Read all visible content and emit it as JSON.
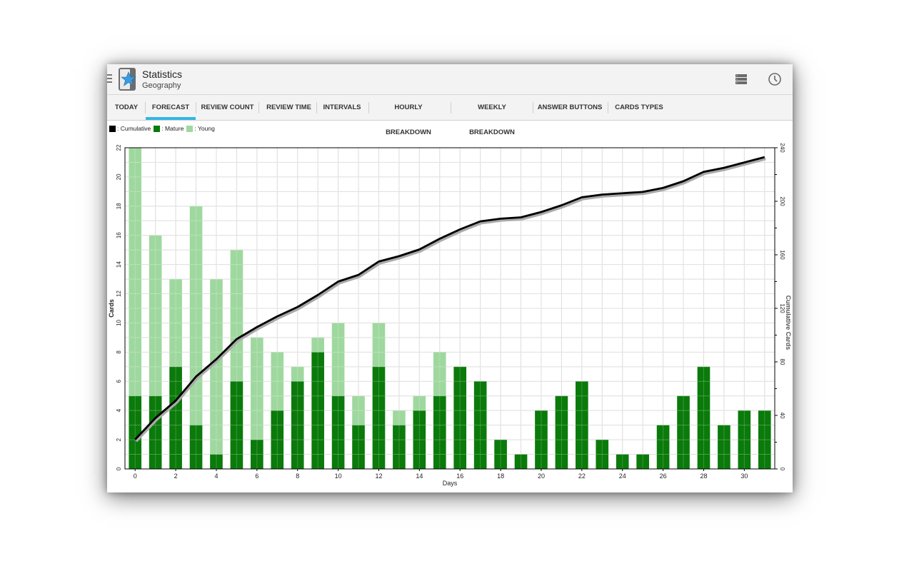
{
  "header": {
    "title": "Statistics",
    "subtitle": "Geography"
  },
  "icons": {
    "menu": "hamburger-icon",
    "app": "anki-app-icon",
    "deck_list": "list-icon",
    "time_scope": "clock-icon"
  },
  "tabs": [
    {
      "label": "TODAY"
    },
    {
      "label": "FORECAST"
    },
    {
      "label": "REVIEW COUNT"
    },
    {
      "label": "REVIEW TIME"
    },
    {
      "label": "INTERVALS"
    },
    {
      "label": "HOURLY BREAKDOWN"
    },
    {
      "label": "WEEKLY BREAKDOWN"
    },
    {
      "label": "ANSWER BUTTONS"
    },
    {
      "label": "CARDS TYPES"
    }
  ],
  "active_tab": "FORECAST",
  "colors": {
    "accent": "#33b5e5",
    "mature": "#0a7a0a",
    "young": "#9fd89f",
    "cumulative": "#000000"
  },
  "legend": [
    {
      "label": ": Cumulative",
      "color": "#000000"
    },
    {
      "label": ": Mature",
      "color": "#0a7a0a"
    },
    {
      "label": ": Young",
      "color": "#9fd89f"
    }
  ],
  "chart_data": {
    "type": "bar",
    "stacked": true,
    "xlabel": "Days",
    "ylabel": "Cards",
    "y2label": "Cumulative Cards",
    "x_ticks": [
      "0",
      "2",
      "4",
      "6",
      "8",
      "10",
      "12",
      "14",
      "16",
      "18",
      "20",
      "22",
      "24",
      "26",
      "28",
      "30"
    ],
    "y_ticks": [
      "0",
      "2",
      "4",
      "6",
      "8",
      "10",
      "12",
      "14",
      "16",
      "18",
      "20",
      "22"
    ],
    "y2_ticks": [
      "0",
      "40",
      "80",
      "120",
      "160",
      "200",
      "240"
    ],
    "xlim": [
      -0.5,
      31.5
    ],
    "ylim": [
      0,
      22
    ],
    "y2lim": [
      0,
      240
    ],
    "grid": true,
    "x": [
      0,
      1,
      2,
      3,
      4,
      5,
      6,
      7,
      8,
      9,
      10,
      11,
      12,
      13,
      14,
      15,
      16,
      17,
      18,
      19,
      20,
      21,
      22,
      23,
      24,
      25,
      26,
      27,
      28,
      29,
      30,
      31
    ],
    "series": [
      {
        "name": "Mature",
        "values": [
          5,
          5,
          7,
          3,
          1,
          6,
          2,
          4,
          6,
          8,
          5,
          3,
          7,
          3,
          4,
          5,
          7,
          6,
          2,
          1,
          4,
          5,
          6,
          2,
          1,
          1,
          3,
          5,
          7,
          3,
          4,
          4
        ]
      },
      {
        "name": "Young",
        "values": [
          17,
          11,
          6,
          15,
          12,
          9,
          7,
          4,
          1,
          1,
          5,
          2,
          3,
          1,
          1,
          3,
          0,
          0,
          0,
          0,
          0,
          0,
          0,
          0,
          0,
          0,
          0,
          0,
          0,
          0,
          0,
          0
        ]
      },
      {
        "name": "Cumulative",
        "axis": "right",
        "values": [
          22,
          38,
          51,
          69,
          82,
          97,
          106,
          114,
          121,
          130,
          140,
          145,
          155,
          159,
          164,
          172,
          179,
          185,
          187,
          188,
          192,
          197,
          203,
          205,
          206,
          207,
          210,
          215,
          222,
          225,
          229,
          233
        ]
      }
    ]
  }
}
